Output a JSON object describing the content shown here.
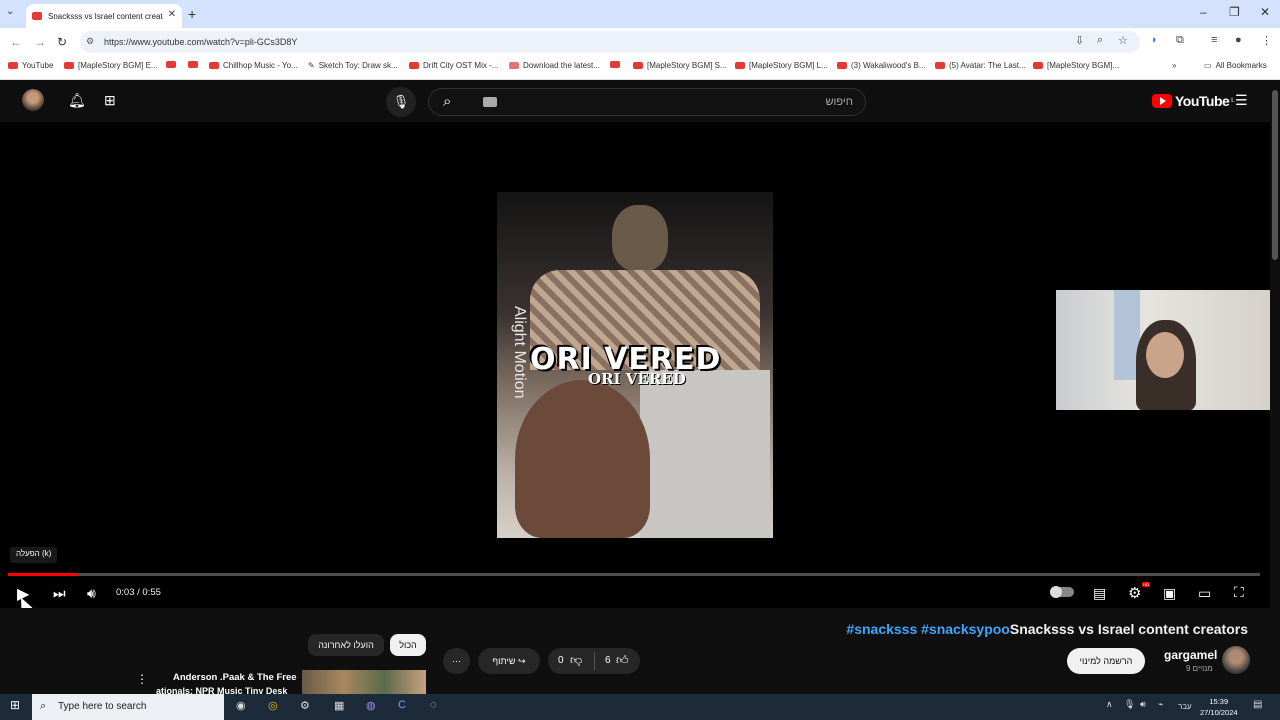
{
  "browser": {
    "tab_title": "Snacksss vs Israel content creat",
    "url": "https://www.youtube.com/watch?v=pli-GCs3D8Y",
    "bookmarks": [
      "YouTube",
      "[MapleStory BGM] E...",
      "",
      "",
      "Chillhop Music - Yo...",
      "Sketch Toy: Draw sk...",
      "Drift City OST Mix -...",
      "Download the latest...",
      "",
      "[MapleStory BGM] S...",
      "[MapleStory BGM] L...",
      "(3) Wakaliwood's B...",
      "(5) Avatar: The Last...",
      "[MapleStory BGM]..."
    ],
    "all_bookmarks": "All Bookmarks"
  },
  "youtube": {
    "search_placeholder": "חיפוש",
    "logo": "YouTube",
    "logo_region": "IL"
  },
  "video": {
    "watermark": "Alight Motion",
    "overlay_title": "ORI VERED",
    "overlay_sub": "ORI VERED",
    "tooltip": "הפעלה (k)",
    "time": "0:03 / 0:55",
    "progress": 0.055,
    "hd_badge": "HD"
  },
  "info": {
    "hashtags": "#snacksss #snacksypoo",
    "title": "Snacksss vs Israel content creators",
    "channel": "gargamel",
    "subscribers": "9 מנויים",
    "subscribe": "הרשמה למינוי",
    "likes": "6",
    "dislikes": "0",
    "share": "שיתוף",
    "chip_all": "הכול",
    "chip_recent": "הועלו לאחרונה",
    "related_title": "Anderson .Paak & The Free",
    "related_sub": "ationals: NPR Music Tiny Desk"
  },
  "taskbar": {
    "search_placeholder": "Type here to search",
    "lang": "עבר",
    "time": "15:39",
    "date": "27/10/2024"
  }
}
